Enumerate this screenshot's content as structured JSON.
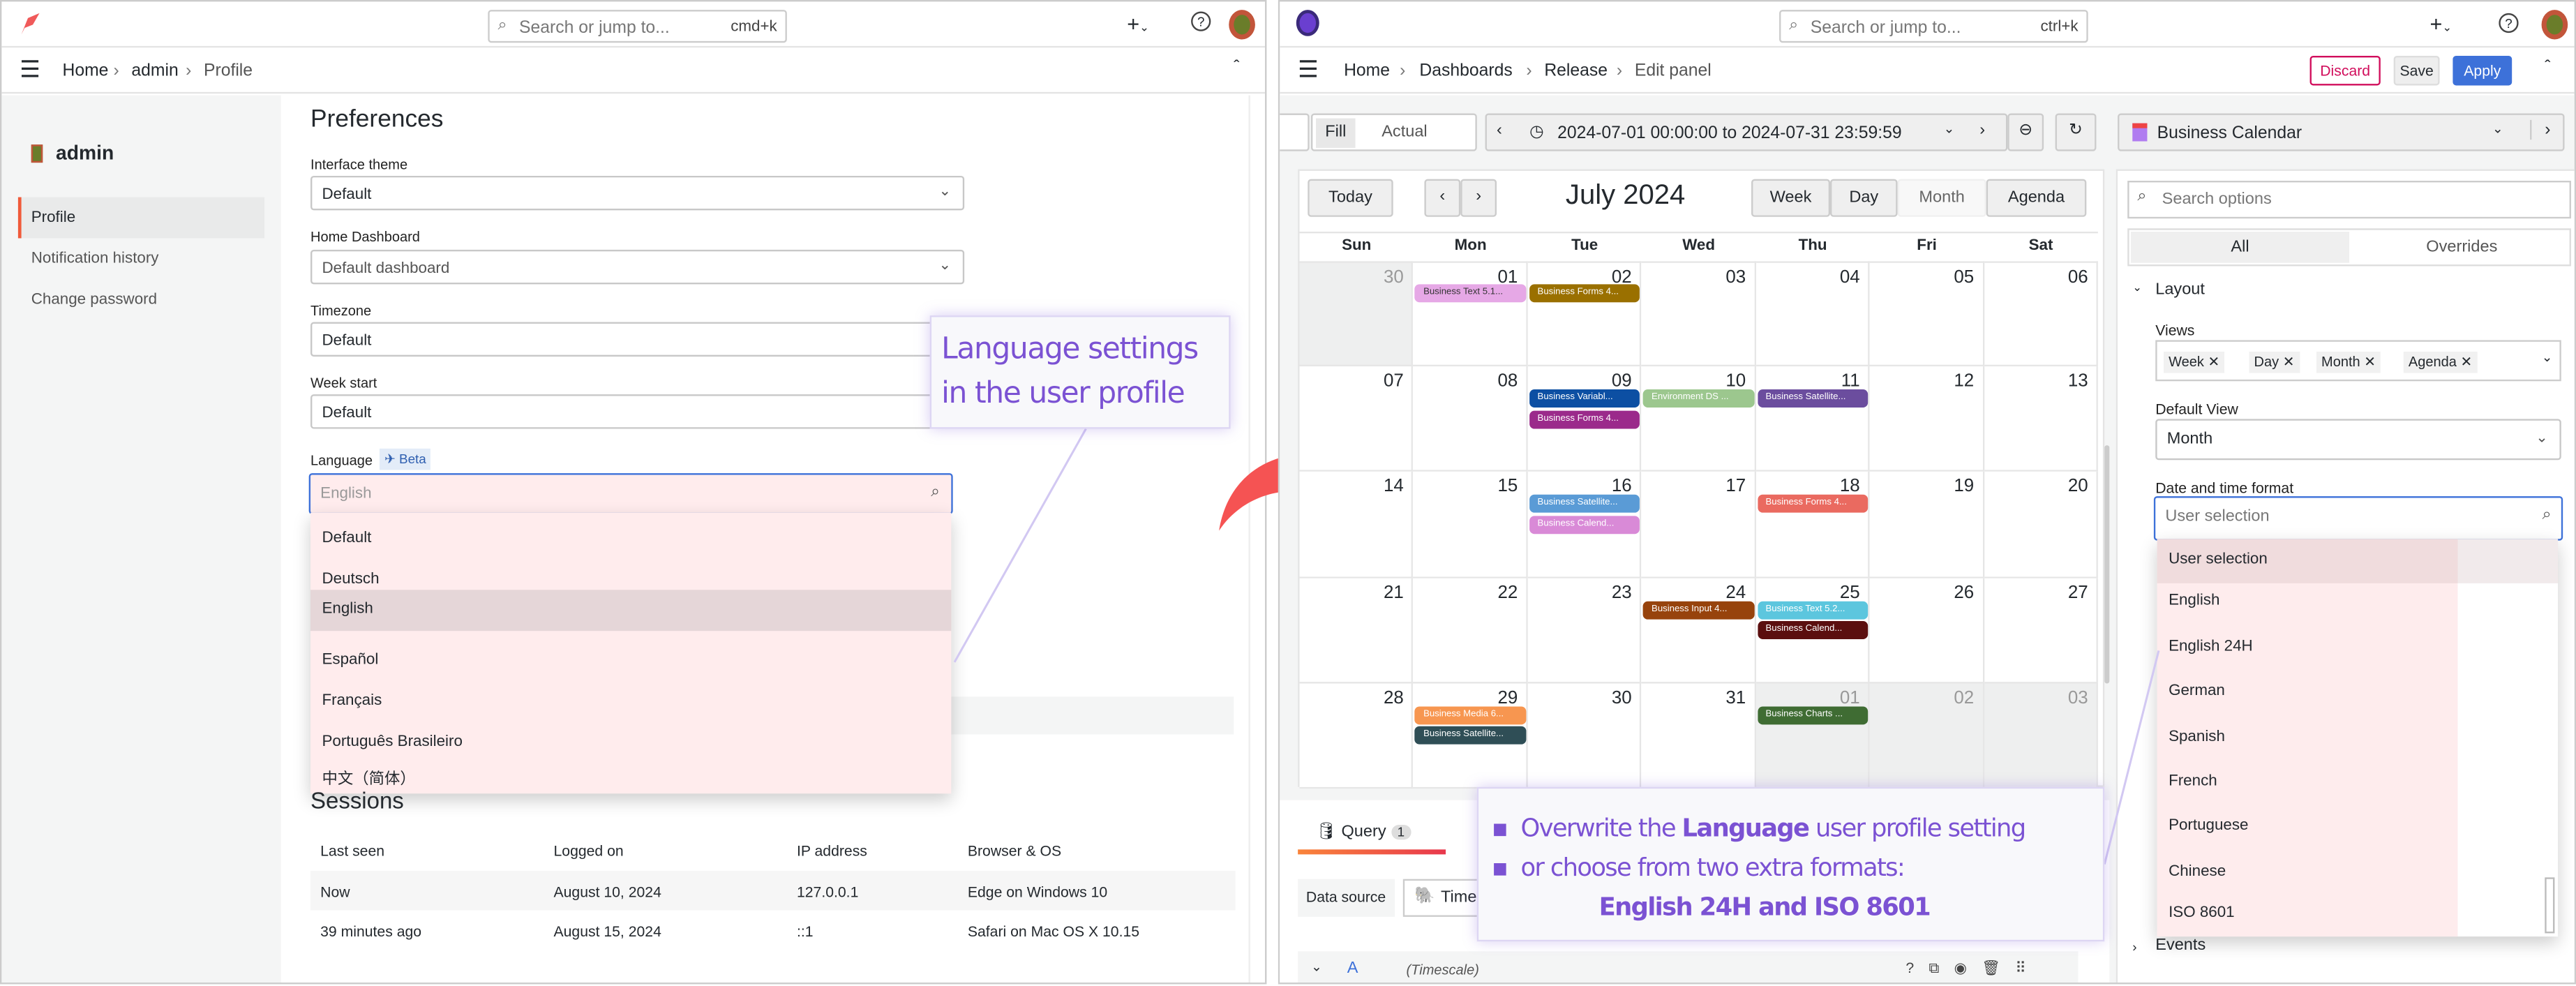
{
  "left": {
    "topbar": {
      "search_placeholder": "Search or jump to...",
      "shortcut": "cmd+k"
    },
    "breadcrumb": [
      "Home",
      "admin",
      "Profile"
    ],
    "sidebar": {
      "user": "admin",
      "items": [
        "Profile",
        "Notification history",
        "Change password"
      ]
    },
    "preferences": {
      "title": "Preferences",
      "fields": [
        {
          "label": "Interface theme",
          "value": "Default"
        },
        {
          "label": "Home Dashboard",
          "value": "Default dashboard"
        },
        {
          "label": "Timezone",
          "value": "Default"
        },
        {
          "label": "Week start",
          "value": "Default"
        }
      ],
      "language": {
        "label": "Language",
        "badge": "Beta",
        "placeholder": "English",
        "options": [
          "Default",
          "Deutsch",
          "English",
          "Español",
          "Français",
          "Português Brasileiro",
          "中文（简体）"
        ],
        "selected": "English"
      }
    },
    "sessions": {
      "title": "Sessions",
      "headers": [
        "Last seen",
        "Logged on",
        "IP address",
        "Browser & OS"
      ],
      "rows": [
        [
          "Now",
          "August 10, 2024",
          "127.0.0.1",
          "Edge on Windows 10"
        ],
        [
          "39 minutes ago",
          "August 15, 2024",
          "::1",
          "Safari on Mac OS X 10.15"
        ]
      ]
    },
    "callout": [
      "Language settings",
      "in the user profile"
    ]
  },
  "right": {
    "topbar": {
      "search_placeholder": "Search or jump to...",
      "shortcut": "ctrl+k"
    },
    "breadcrumb": [
      "Home",
      "Dashboards",
      "Release",
      "Edit panel"
    ],
    "actions": {
      "discard": "Discard",
      "save": "Save",
      "apply": "Apply"
    },
    "toolbar": {
      "fill": "Fill",
      "actual": "Actual",
      "time_range": "2024-07-01 00:00:00 to 2024-07-31 23:59:59",
      "visualization": "Business Calendar"
    },
    "calendar": {
      "today": "Today",
      "title": "July 2024",
      "views": [
        "Week",
        "Day",
        "Month",
        "Agenda"
      ],
      "active_view": "Month",
      "weekdays": [
        "Sun",
        "Mon",
        "Tue",
        "Wed",
        "Thu",
        "Fri",
        "Sat"
      ],
      "weeks": [
        [
          "30",
          "01",
          "02",
          "03",
          "04",
          "05",
          "06"
        ],
        [
          "07",
          "08",
          "09",
          "10",
          "11",
          "12",
          "13"
        ],
        [
          "14",
          "15",
          "16",
          "17",
          "18",
          "19",
          "20"
        ],
        [
          "21",
          "22",
          "23",
          "24",
          "25",
          "26",
          "27"
        ],
        [
          "28",
          "29",
          "30",
          "31",
          "01",
          "02",
          "03"
        ]
      ],
      "outside": [
        [
          0,
          0
        ],
        [
          4,
          4
        ],
        [
          4,
          5
        ],
        [
          4,
          6
        ]
      ],
      "events": [
        {
          "week": 0,
          "day": 1,
          "slot": 0,
          "title": "Business Text 5.1...",
          "color": "#e6a8e6",
          "text": "#333"
        },
        {
          "week": 0,
          "day": 2,
          "slot": 0,
          "title": "Business Forms 4...",
          "color": "#9a7000"
        },
        {
          "week": 1,
          "day": 2,
          "slot": 0,
          "title": "Business Variabl...",
          "color": "#0c4fa3"
        },
        {
          "week": 1,
          "day": 2,
          "slot": 1,
          "title": "Business Forms 4...",
          "color": "#9b2a8b"
        },
        {
          "week": 1,
          "day": 3,
          "slot": 0,
          "title": "Environment DS ...",
          "color": "#9cc78e"
        },
        {
          "week": 1,
          "day": 4,
          "slot": 0,
          "title": "Business Satellite...",
          "color": "#6b4d9e"
        },
        {
          "week": 2,
          "day": 2,
          "slot": 0,
          "title": "Business Satellite...",
          "color": "#5a9bd6"
        },
        {
          "week": 2,
          "day": 2,
          "slot": 1,
          "title": "Business Calend...",
          "color": "#d98ad7"
        },
        {
          "week": 2,
          "day": 4,
          "slot": 0,
          "title": "Business Forms 4...",
          "color": "#ea6a60"
        },
        {
          "week": 3,
          "day": 3,
          "slot": 0,
          "title": "Business Input 4...",
          "color": "#97430c"
        },
        {
          "week": 3,
          "day": 4,
          "slot": 0,
          "title": "Business Text 5.2...",
          "color": "#5cc6de"
        },
        {
          "week": 3,
          "day": 4,
          "slot": 1,
          "title": "Business Calend...",
          "color": "#5b0f0f"
        },
        {
          "week": 4,
          "day": 1,
          "slot": 0,
          "title": "Business Media 6...",
          "color": "#f79650"
        },
        {
          "week": 4,
          "day": 1,
          "slot": 1,
          "title": "Business Satellite...",
          "color": "#2f4e56"
        },
        {
          "week": 4,
          "day": 4,
          "slot": 0,
          "title": "Business Charts ...",
          "color": "#3f6c33"
        }
      ]
    },
    "query": {
      "tab": "Query",
      "count": "1",
      "data_source_label": "Data source",
      "data_source": "Timescale",
      "row_letter": "A",
      "row_source": "(Timescale)"
    },
    "options": {
      "search_placeholder": "Search options",
      "tabs": [
        "All",
        "Overrides"
      ],
      "section": "Layout",
      "views_label": "Views",
      "views": [
        "Week",
        "Day",
        "Month",
        "Agenda"
      ],
      "default_view_label": "Default View",
      "default_view": "Month",
      "datetime_label": "Date and time format",
      "datetime_placeholder": "User selection",
      "datetime_options": [
        "User selection",
        "English",
        "English 24H",
        "German",
        "Spanish",
        "French",
        "Portuguese",
        "Chinese",
        "ISO 8601"
      ],
      "next_section": "Events"
    },
    "callout": {
      "line1_pre": "Overwrite the ",
      "line1_bold": "Language",
      "line1_post": " user profile setting",
      "line2": "or choose from two extra formats:",
      "line3": "English 24H and ISO 8601"
    }
  },
  "colors": {
    "accent_blue": "#3d71d9",
    "discard": "#d10e5c",
    "callout_text": "#7b52d3",
    "arrow": "#f55353",
    "dropdown_highlight": "#ffeced"
  }
}
